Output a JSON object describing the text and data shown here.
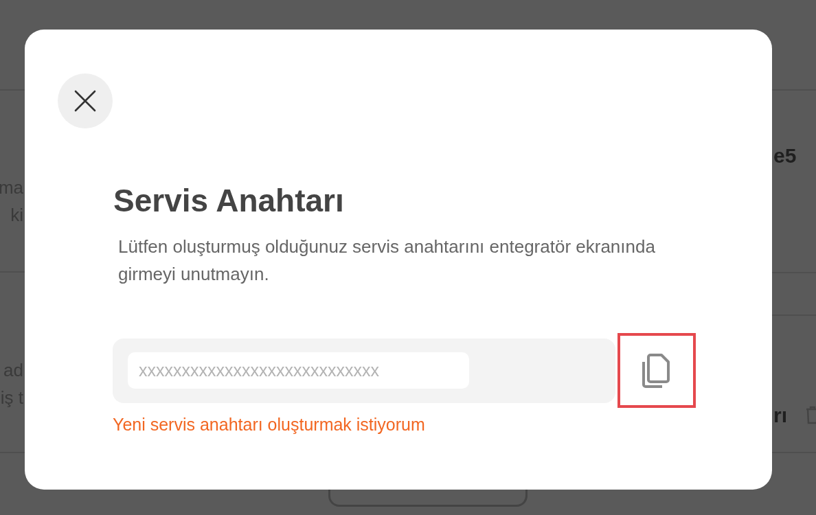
{
  "background_page": {
    "fragments": [
      {
        "text": "ma",
        "kind": "left-edge"
      },
      {
        "text": "ki",
        "kind": "left-edge"
      },
      {
        "text": "ad",
        "kind": "left-edge"
      },
      {
        "text": "iş t",
        "kind": "left-edge"
      },
      {
        "text": "e5",
        "kind": "right-edge"
      },
      {
        "text": "rı",
        "kind": "right-edge"
      }
    ]
  },
  "dialog": {
    "title": "Servis Anahtarı",
    "description": "Lütfen oluşturmuş olduğunuz servis anahtarını entegratör ekranında girmeyi unutmayın.",
    "key_field": {
      "placeholder": "xxxxxxxxxxxxxxxxxxxxxxxxxxxx"
    },
    "copy_button": {
      "highlighted": true
    },
    "regenerate_link": "Yeni servis anahtarı oluşturmak istiyorum"
  }
}
